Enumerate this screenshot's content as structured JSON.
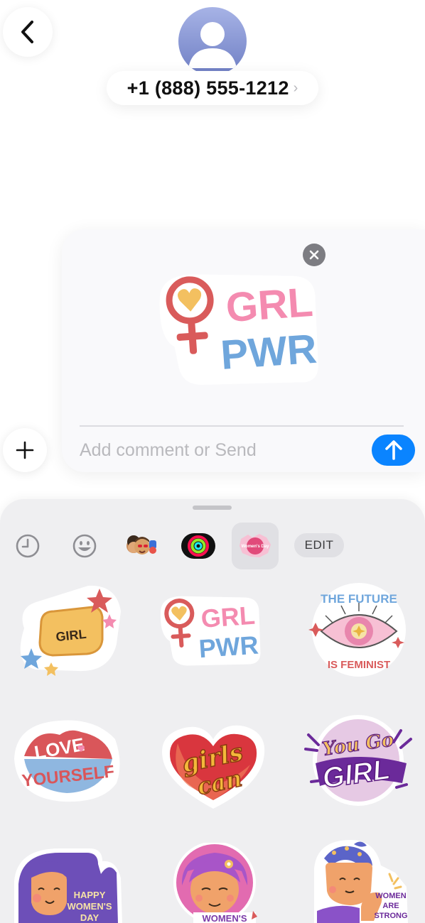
{
  "header": {
    "contact_name": "+1 (888) 555-1212",
    "contact_chevron": "›"
  },
  "compose": {
    "placeholder": "Add comment or Send",
    "attached_sticker": {
      "name": "grl-pwr-sticker",
      "line1": "GRL",
      "line2": "PWR"
    }
  },
  "drawer": {
    "tabs": [
      {
        "name": "recents-tab",
        "icon": "clock-icon"
      },
      {
        "name": "emoji-tab",
        "icon": "smiley-icon"
      },
      {
        "name": "memoji-tab",
        "icon": "memoji-stickers-icon"
      },
      {
        "name": "activity-tab",
        "icon": "activity-rings-icon"
      },
      {
        "name": "womens-day-pack-tab",
        "icon": "womens-day-pack-icon",
        "selected": true,
        "badge_text": "Women's Day"
      }
    ],
    "edit_label": "EDIT",
    "stickers": [
      {
        "name": "girl-fist-sticker",
        "text": "GIRL"
      },
      {
        "name": "grl-pwr-sticker",
        "line1": "GRL",
        "line2": "PWR"
      },
      {
        "name": "future-is-feminist-sticker",
        "top": "THE FUTURE",
        "bottom": "IS FEMINIST"
      },
      {
        "name": "love-yourself-sticker",
        "line1": "LOVE",
        "line2": "YOURSELF"
      },
      {
        "name": "girls-can-sticker",
        "line1": "girls",
        "line2": "can"
      },
      {
        "name": "you-go-girl-sticker",
        "line1": "You Go",
        "line2": "GIRL"
      },
      {
        "name": "happy-womens-day-sticker",
        "line1": "HAPPY",
        "line2": "WOMEN'S",
        "line3": "DAY"
      },
      {
        "name": "womens-sticker",
        "text": "WOMEN'S"
      },
      {
        "name": "women-are-strong-sticker",
        "line1": "WOMEN",
        "line2": "ARE",
        "line3": "STRONG"
      }
    ]
  },
  "colors": {
    "send_blue": "#0a84ff",
    "grl_pink": "#f48bb0",
    "pwr_blue": "#6fa6dc",
    "venus_red": "#d95b5b",
    "heart_yellow": "#f3c060"
  }
}
